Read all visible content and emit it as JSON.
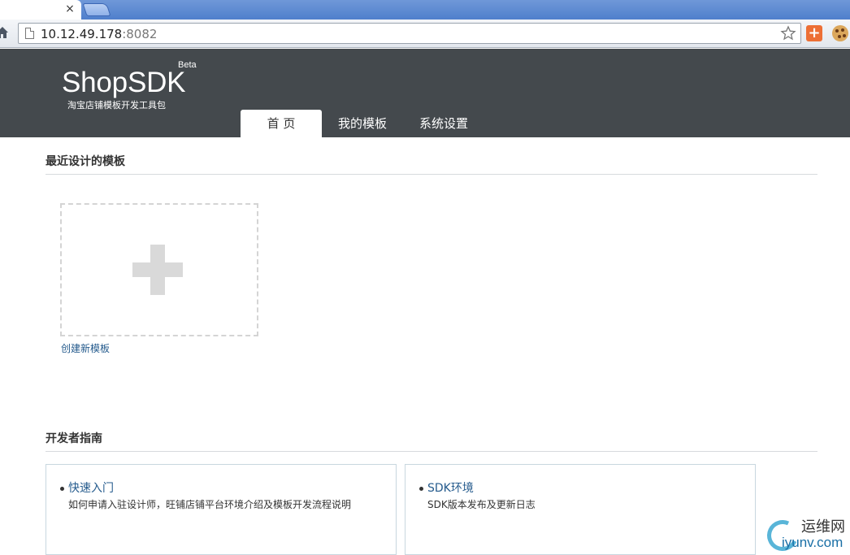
{
  "browser": {
    "tab_close_label": "×",
    "url_host": "10.12.49.178",
    "url_port": ":8082",
    "extension_plus_label": "+"
  },
  "header": {
    "logo_text": "ShopSDK",
    "beta_label": "Beta",
    "tagline": "淘宝店铺模板开发工具包",
    "tabs": [
      {
        "label": "首 页",
        "active": true
      },
      {
        "label": "我的模板",
        "active": false
      },
      {
        "label": "系统设置",
        "active": false
      }
    ]
  },
  "recent": {
    "title": "最近设计的模板",
    "create_label": "创建新模板"
  },
  "guide": {
    "title": "开发者指南",
    "cards": [
      {
        "title": "快速入门",
        "description": "如何申请入驻设计师，旺铺店铺平台环境介绍及模板开发流程说明"
      },
      {
        "title": "SDK环境",
        "description": "SDK版本发布及更新日志"
      }
    ]
  },
  "watermark": {
    "cn": "运维网",
    "en": "iyunv.com"
  },
  "colors": {
    "header_bg": "#44494d",
    "link": "#255b8d",
    "tabstrip": "#5b88d2"
  },
  "icons": [
    "home-icon",
    "page-icon",
    "star-icon",
    "plus-icon",
    "cookie-icon"
  ]
}
